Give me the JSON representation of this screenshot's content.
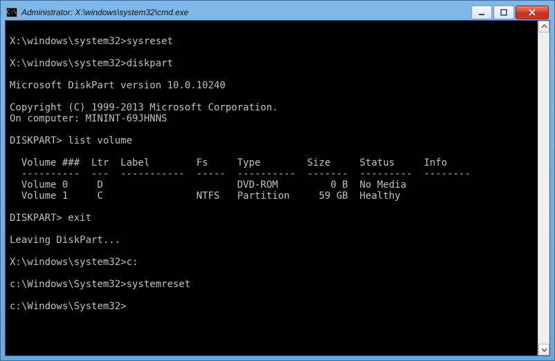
{
  "window": {
    "title": "Administrator: X:\\windows\\system32\\cmd.exe",
    "icon_glyph": "C:\\"
  },
  "terminal": {
    "lines": [
      "",
      "X:\\windows\\system32>sysreset",
      "",
      "X:\\windows\\system32>diskpart",
      "",
      "Microsoft DiskPart version 10.0.10240",
      "",
      "Copyright (C) 1999-2013 Microsoft Corporation.",
      "On computer: MININT-69JHNNS",
      "",
      "DISKPART> list volume",
      "",
      "  Volume ###  Ltr  Label        Fs     Type        Size     Status     Info",
      "  ----------  ---  -----------  -----  ----------  -------  ---------  --------",
      "  Volume 0     D                       DVD-ROM         0 B  No Media",
      "  Volume 1     C                NTFS   Partition     59 GB  Healthy",
      "",
      "DISKPART> exit",
      "",
      "Leaving DiskPart...",
      "",
      "X:\\windows\\system32>c:",
      "",
      "c:\\Windows\\System32>systemreset",
      "",
      "c:\\Windows\\System32>"
    ]
  }
}
